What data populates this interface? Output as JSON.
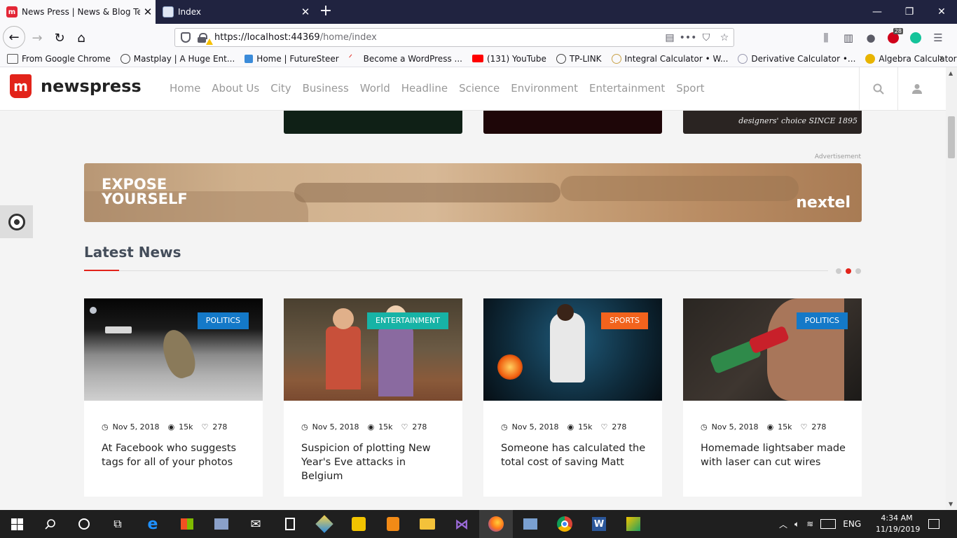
{
  "browser": {
    "tabs": [
      {
        "title": "News Press | News & Blog Temp",
        "favicon": "M",
        "active": true
      },
      {
        "title": "Index",
        "active": false
      }
    ],
    "url_host": "https://localhost:44369",
    "url_path": "/home/index",
    "addon_badge": "28",
    "bookmarks": [
      {
        "label": "From Google Chrome",
        "icon": "folder-icon",
        "color": "#7a7a7a"
      },
      {
        "label": "Mastplay | A Huge Ent...",
        "icon": "globe-icon",
        "color": "#555555"
      },
      {
        "label": "Home | FutureSteer",
        "icon": "futuresteer-icon",
        "color": "#3b8bd9"
      },
      {
        "label": "Become a WordPress ...",
        "icon": "wordpress-icon",
        "color": "#e2231a"
      },
      {
        "label": "(131) YouTube",
        "icon": "youtube-icon",
        "color": "#ff0000"
      },
      {
        "label": "TP-LINK",
        "icon": "globe-icon",
        "color": "#555555"
      },
      {
        "label": "Integral Calculator • W...",
        "icon": "calculator-icon",
        "color": "#c9a24a"
      },
      {
        "label": "Derivative Calculator •...",
        "icon": "calculator-icon",
        "color": "#9a9ab0"
      },
      {
        "label": "Algebra Calculator - ...",
        "icon": "calculator-icon",
        "color": "#e8b400"
      }
    ]
  },
  "site": {
    "logo_mark": "m",
    "logo_text": "newspress",
    "nav": [
      "Home",
      "About Us",
      "City",
      "Business",
      "World",
      "Headline",
      "Science",
      "Environment",
      "Entertainment",
      "Sport"
    ],
    "top_thumb_text": "designers' choice SINCE 1895",
    "ad_label": "Advertisement",
    "banner": {
      "slogan_line1": "EXPOSE",
      "slogan_line2": "YOURSELF",
      "brand": "nextel"
    },
    "section_title": "Latest News",
    "carousel_active_index": 1,
    "carousel_count": 3,
    "cards": [
      {
        "category": "POLITICS",
        "category_color": "#1479c8",
        "date": "Nov 5, 2018",
        "views": "15k",
        "likes": "278",
        "headline": "At Facebook who suggests tags for all of your photos"
      },
      {
        "category": "ENTERTAINMENT",
        "category_color": "#17b3a6",
        "date": "Nov 5, 2018",
        "views": "15k",
        "likes": "278",
        "headline": "Suspicion of plotting New Year's Eve attacks in Belgium"
      },
      {
        "category": "SPORTS",
        "category_color": "#f2631d",
        "date": "Nov 5, 2018",
        "views": "15k",
        "likes": "278",
        "headline": "Someone has calculated the total cost of saving Matt"
      },
      {
        "category": "POLITICS",
        "category_color": "#1479c8",
        "date": "Nov 5, 2018",
        "views": "15k",
        "likes": "278",
        "headline": "Homemade lightsaber made with laser can cut wires"
      }
    ]
  },
  "taskbar": {
    "language": "ENG",
    "time": "4:34 AM",
    "date": "11/19/2019"
  }
}
